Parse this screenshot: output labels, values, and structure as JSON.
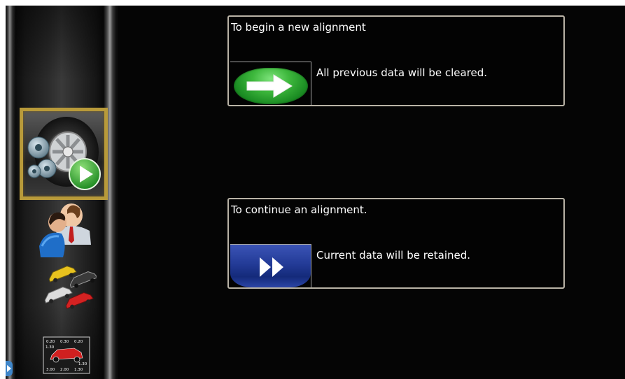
{
  "sidebar": {
    "items": [
      {
        "name": "alignment",
        "icon": "tire-gears-play-icon"
      },
      {
        "name": "customer",
        "icon": "customer-icon"
      },
      {
        "name": "vehicles",
        "icon": "vehicles-icon"
      },
      {
        "name": "specifications",
        "icon": "vehicle-specs-icon"
      }
    ],
    "specs_values": [
      "0.20",
      "0.30",
      "0.20",
      "1.30",
      "1.30",
      "3.00",
      "2.00",
      "1.30"
    ],
    "accent_border": "#b89a3a"
  },
  "panels": {
    "new_alignment": {
      "title": "To begin a new alignment",
      "description": "All previous data will be cleared.",
      "button_icon": "right-arrow-icon",
      "button_color": "#3eb83d"
    },
    "continue_alignment": {
      "title": "To continue an alignment.",
      "description": "Current data will be retained.",
      "button_icon": "fast-forward-icon",
      "button_color": "#233b97"
    }
  }
}
